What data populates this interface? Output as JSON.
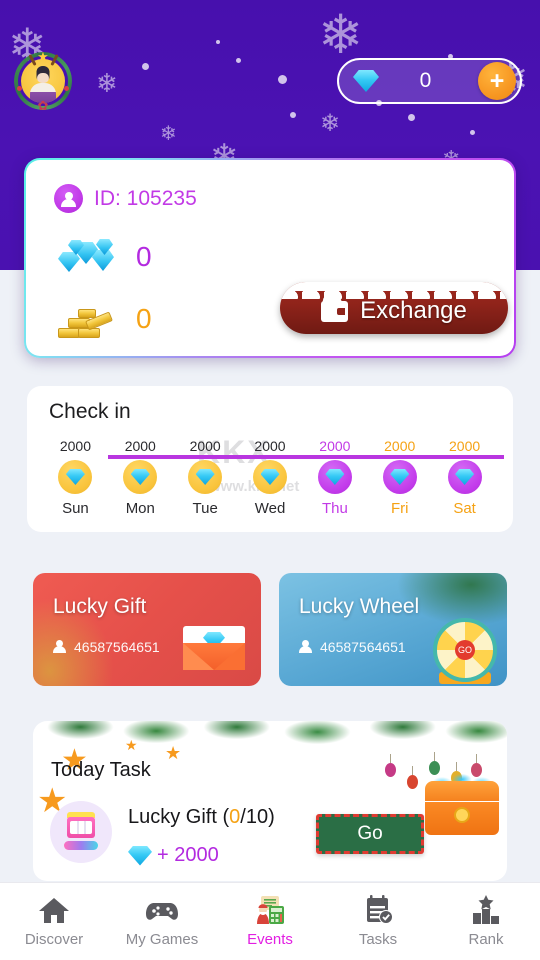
{
  "header": {
    "avatar_name": "user-avatar",
    "gem_icon": "diamond-icon",
    "gem_balance": "0",
    "plus_label": "+"
  },
  "user_card": {
    "id_label": "ID: 105235",
    "gem_icon": "gem-pile-icon",
    "gem_value": "0",
    "gold_icon": "gold-bars-icon",
    "gold_value": "0",
    "exchange_label": "Exchange",
    "exchange_icon": "wallet-icon"
  },
  "checkin": {
    "title": "Check in",
    "watermark_top": "KKX",
    "watermark_bottom": "www.kkx.net",
    "days": [
      {
        "amount": "2000",
        "name": "Sun",
        "state": "claimed"
      },
      {
        "amount": "2000",
        "name": "Mon",
        "state": "claimed"
      },
      {
        "amount": "2000",
        "name": "Tue",
        "state": "claimed"
      },
      {
        "amount": "2000",
        "name": "Wed",
        "state": "claimed"
      },
      {
        "amount": "2000",
        "name": "Thu",
        "state": "today"
      },
      {
        "amount": "2000",
        "name": "Fri",
        "state": "upcoming"
      },
      {
        "amount": "2000",
        "name": "Sat",
        "state": "upcoming"
      }
    ]
  },
  "promos": [
    {
      "title": "Lucky Gift",
      "count": "46587564651",
      "icon": "envelope-icon",
      "color": "#e5504a"
    },
    {
      "title": "Lucky Wheel",
      "count": "46587564651",
      "icon": "lucky-wheel-icon",
      "color": "#59a8d4"
    }
  ],
  "task": {
    "title": "Today Task",
    "icon": "slot-machine-icon",
    "name": "Lucky Gift",
    "progress_current": "0",
    "progress_rest": "/10)",
    "progress_open": "(",
    "reward_icon": "diamond-icon",
    "reward_text": "+ 2000",
    "go_label": "Go",
    "chest_icon": "treasure-chest-icon"
  },
  "nav": {
    "items": [
      {
        "label": "Discover",
        "icon": "home-icon",
        "active": false
      },
      {
        "label": "My Games",
        "icon": "gamepad-icon",
        "active": false
      },
      {
        "label": "Events",
        "icon": "events-icon",
        "active": true
      },
      {
        "label": "Tasks",
        "icon": "checklist-icon",
        "active": false
      },
      {
        "label": "Rank",
        "icon": "podium-icon",
        "active": false
      }
    ]
  },
  "colors": {
    "background_purple": "#4a11b0",
    "accent_magenta": "#c23ae6",
    "accent_gold": "#f5a214",
    "page_bg": "#eef1f7"
  }
}
